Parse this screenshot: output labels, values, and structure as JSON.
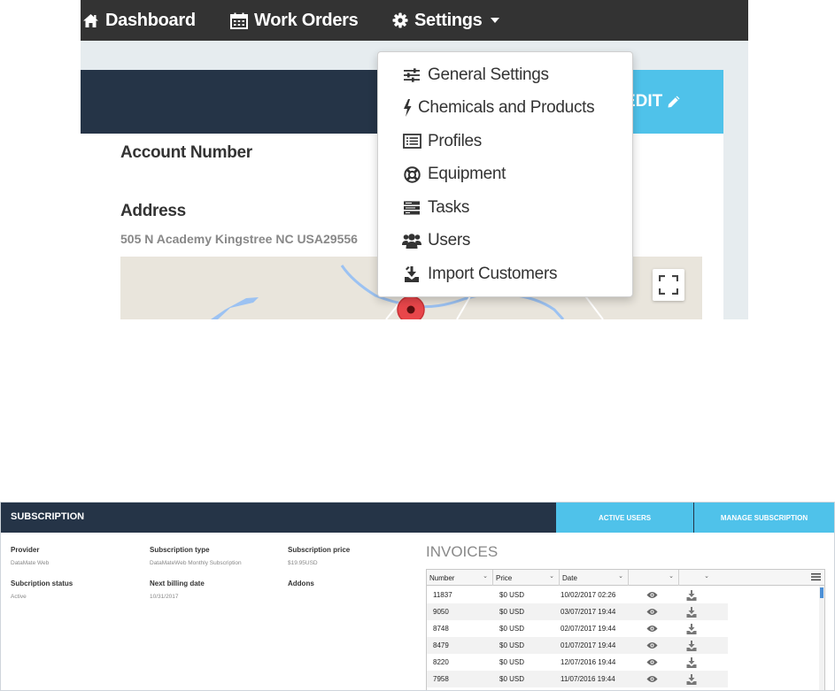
{
  "nav": {
    "dashboard": "Dashboard",
    "work_orders": "Work Orders",
    "settings": "Settings"
  },
  "panel": {
    "edit_label": "EDIT",
    "account_number_label": "Account Number",
    "address_label": "Address",
    "address_value": "505 N Academy Kingstree NC USA29556"
  },
  "settings_menu": {
    "items": [
      {
        "label": "General Settings",
        "icon": "sliders-icon"
      },
      {
        "label": "Chemicals and Products",
        "icon": "bolt-icon"
      },
      {
        "label": "Profiles",
        "icon": "list-alt-icon"
      },
      {
        "label": "Equipment",
        "icon": "life-ring-icon"
      },
      {
        "label": "Tasks",
        "icon": "tasks-icon"
      },
      {
        "label": "Users",
        "icon": "users-icon"
      },
      {
        "label": "Import Customers",
        "icon": "import-icon"
      }
    ]
  },
  "subscription": {
    "title": "SUBSCRIPTION",
    "active_users_label": "ACTIVE USERS",
    "manage_label": "MANAGE SUBSCRIPTION",
    "provider_label": "Provider",
    "provider_value": "DataMate Web",
    "type_label": "Subscription type",
    "type_value": "DataMateWeb Monthly Subscription",
    "price_label": "Subscription price",
    "price_value": "$19.95USD",
    "status_label": "Subcription status",
    "status_value": "Active",
    "billing_label": "Next billing date",
    "billing_value": "10/31/2017",
    "addons_label": "Addons"
  },
  "invoices": {
    "title": "INVOICES",
    "columns": [
      "Number",
      "Price",
      "Date",
      "",
      ""
    ],
    "rows": [
      {
        "number": "11837",
        "price": "$0 USD",
        "date": "10/02/2017 02:26"
      },
      {
        "number": "9050",
        "price": "$0 USD",
        "date": "03/07/2017 19:44"
      },
      {
        "number": "8748",
        "price": "$0 USD",
        "date": "02/07/2017 19:44"
      },
      {
        "number": "8479",
        "price": "$0 USD",
        "date": "01/07/2017 19:44"
      },
      {
        "number": "8220",
        "price": "$0 USD",
        "date": "12/07/2016 19:44"
      },
      {
        "number": "7958",
        "price": "$0 USD",
        "date": "11/07/2016 19:44"
      }
    ]
  },
  "colors": {
    "navbar": "#333333",
    "header_navy": "#253447",
    "accent_blue": "#4fc2ea"
  }
}
